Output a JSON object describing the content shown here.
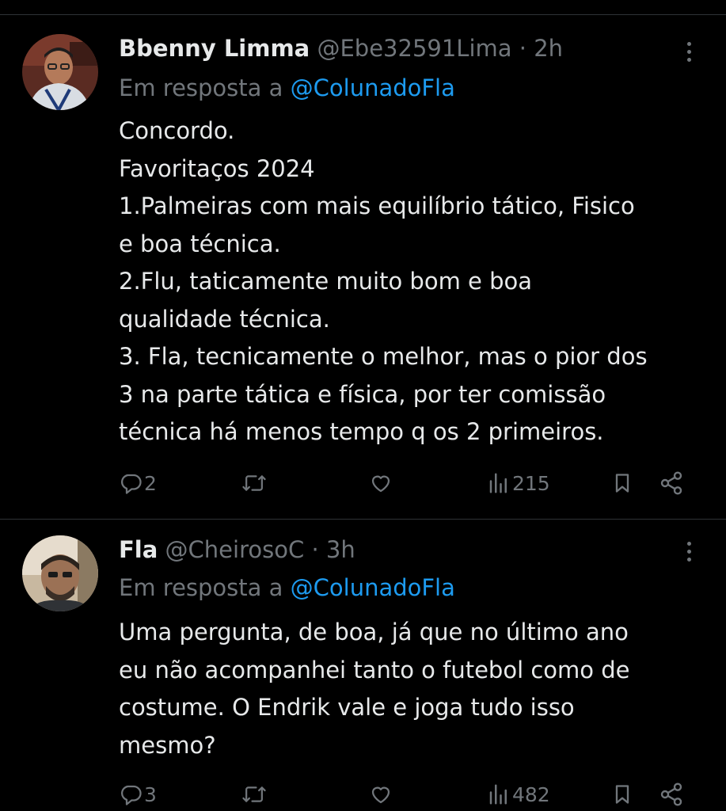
{
  "tweets": [
    {
      "author": {
        "name": "Bbenny Limma",
        "handle": "@Ebe32591Lima",
        "time": "2h"
      },
      "reply_prefix": "Em resposta a",
      "reply_to": "@ColunadoFla",
      "body_lines": [
        "Concordo.",
        "Favoritaços 2024",
        "1.Palmeiras com mais equilíbrio tático, Fisico",
        "e boa técnica.",
        "2.Flu, taticamente muito bom e boa",
        "qualidade técnica.",
        "3. Fla, tecnicamente o melhor, mas o pior dos",
        "3 na parte tática e física, por ter comissão",
        "técnica há menos tempo q os 2 primeiros."
      ],
      "stats": {
        "replies": "2",
        "retweets": "",
        "likes": "",
        "views": "215"
      }
    },
    {
      "author": {
        "name": "Fla",
        "handle": "@CheirosoC",
        "time": "3h"
      },
      "reply_prefix": "Em resposta a",
      "reply_to": "@ColunadoFla",
      "body_lines": [
        "Uma pergunta, de boa, já que no último ano",
        "eu não acompanhei tanto o futebol como de",
        "costume. O Endrik vale e joga tudo isso",
        "mesmo?"
      ],
      "stats": {
        "replies": "3",
        "retweets": "",
        "likes": "",
        "views": "482"
      }
    }
  ],
  "separator": "·",
  "colors": {
    "background": "#000000",
    "text_primary": "#e7e9ea",
    "text_secondary": "#71767b",
    "accent": "#1d9bf0",
    "divider": "#2f3336"
  },
  "icons": [
    "more-vertical-icon",
    "reply-icon",
    "retweet-icon",
    "like-icon",
    "views-icon",
    "bookmark-icon",
    "share-icon"
  ]
}
